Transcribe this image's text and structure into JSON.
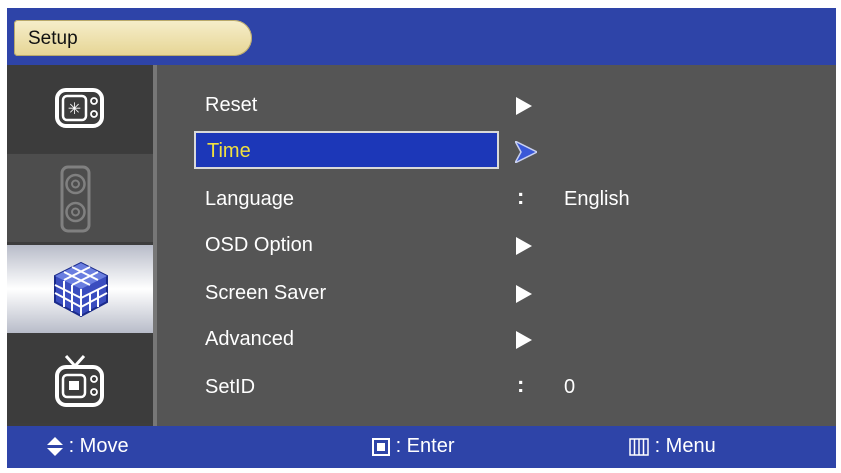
{
  "header": {
    "title": "Setup"
  },
  "sidebar": {
    "items": [
      {
        "icon": "picture-settings-icon"
      },
      {
        "icon": "speaker-icon"
      },
      {
        "icon": "cube-setup-icon",
        "selected": true
      },
      {
        "icon": "tv-icon"
      }
    ]
  },
  "menu": {
    "items": [
      {
        "label": "Reset",
        "indicator": "arrow"
      },
      {
        "label": "Time",
        "indicator": "arrow",
        "selected": true
      },
      {
        "label": "Language",
        "indicator": "colon",
        "value": "English"
      },
      {
        "label": "OSD Option",
        "indicator": "arrow"
      },
      {
        "label": "Screen Saver",
        "indicator": "arrow"
      },
      {
        "label": "Advanced",
        "indicator": "arrow"
      },
      {
        "label": "SetID",
        "indicator": "colon",
        "value": "0"
      }
    ],
    "colon_text": ":"
  },
  "footer": {
    "move": ": Move",
    "enter": ": Enter",
    "menu": ": Menu"
  },
  "colors": {
    "header_bg": "#2e44a8",
    "selection_bg": "#1c37b8",
    "selection_text": "#f0e040",
    "panel_bg": "#555555"
  }
}
